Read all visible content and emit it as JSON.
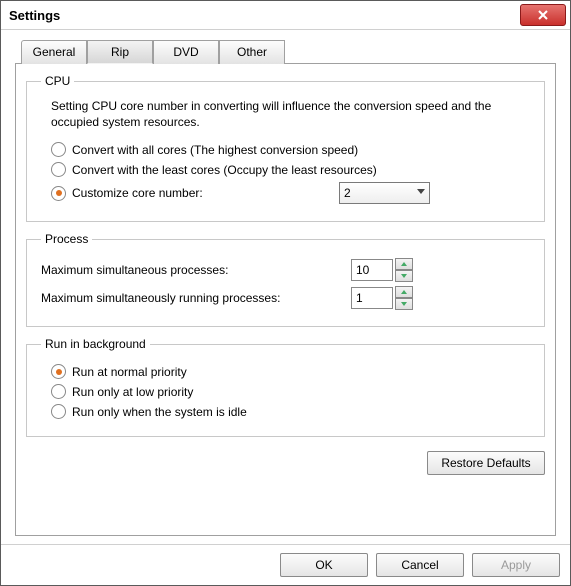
{
  "window": {
    "title": "Settings"
  },
  "tabs": {
    "general": "General",
    "rip": "Rip",
    "dvd": "DVD",
    "other": "Other"
  },
  "cpu": {
    "legend": "CPU",
    "desc": "Setting CPU core number in converting will influence the conversion speed and the occupied system resources.",
    "opt_all": "Convert with all cores (The highest conversion speed)",
    "opt_least": "Convert with the least cores (Occupy the least resources)",
    "opt_custom": "Customize core number:",
    "core_value": "2"
  },
  "process": {
    "legend": "Process",
    "max_sim_label": "Maximum simultaneous processes:",
    "max_sim_value": "10",
    "max_run_label": "Maximum simultaneously running processes:",
    "max_run_value": "1"
  },
  "bg": {
    "legend": "Run in background",
    "opt_normal": "Run at normal priority",
    "opt_low": "Run only at low priority",
    "opt_idle": "Run only when the system is idle"
  },
  "buttons": {
    "restore": "Restore Defaults",
    "ok": "OK",
    "cancel": "Cancel",
    "apply": "Apply"
  }
}
